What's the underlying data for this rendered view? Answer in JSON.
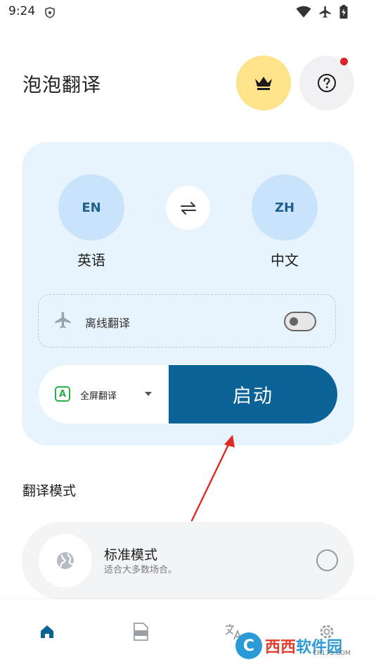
{
  "status_bar": {
    "time": "9:24"
  },
  "header": {
    "title": "泡泡翻译"
  },
  "languages": {
    "source": {
      "code": "EN",
      "name": "英语"
    },
    "target": {
      "code": "ZH",
      "name": "中文"
    }
  },
  "offline": {
    "label": "离线翻译",
    "enabled": false
  },
  "mode_select": {
    "badge": "A",
    "label": "全屏翻译"
  },
  "start_button": {
    "label": "启动"
  },
  "section": {
    "title": "翻译模式"
  },
  "modes": [
    {
      "name": "标准模式",
      "description": "适合大多数场合。",
      "selected": false
    }
  ],
  "watermark": {
    "logo": "C",
    "text_a": "西西",
    "text_b": "软件园",
    "sub": "CR173.COM"
  },
  "colors": {
    "accent": "#0b6296",
    "card_bg": "#e7f3fd",
    "lang_circle": "#c9e3fb",
    "crown_bg": "#fde38a",
    "notif": "#d9232d"
  },
  "icons": {
    "crown": "crown-icon",
    "help": "question-mark-icon",
    "swap": "swap-arrows-icon",
    "offline": "airplane-icon",
    "globe": "globe-icon",
    "nav": [
      "home-icon",
      "pdf-icon",
      "translate-icon",
      "settings-icon"
    ]
  }
}
